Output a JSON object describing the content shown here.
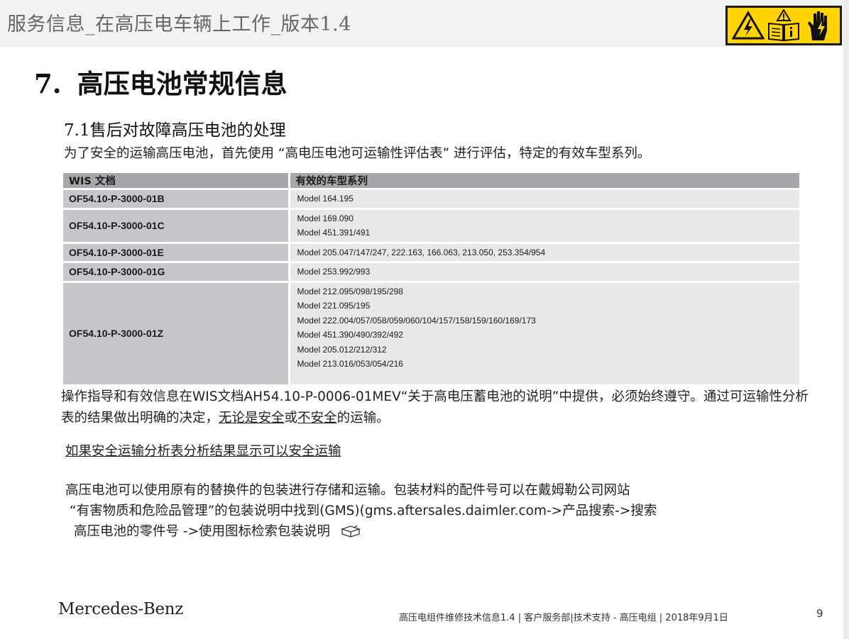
{
  "header": {
    "doc_title": "服务信息_在高压电车辆上工作_版本1.4",
    "warning_icons": [
      "high-voltage-warning-icon",
      "read-manual-icon",
      "no-touch-hand-icon"
    ],
    "warning_color": "#ffd400"
  },
  "section": {
    "number": "7.",
    "title": "高压电池常规信息"
  },
  "subsection": {
    "number": "7.1",
    "title": "售后对故障高压电池的处理"
  },
  "intro": "为了安全的运输高压电池，首先使用 “高电压电池可运输性评估表” 进行评估，特定的有效车型系列。",
  "table": {
    "headers": [
      "WIS 文档",
      "有效的车型系列"
    ],
    "rows": [
      {
        "doc": "OF54.10-P-3000-01B",
        "models": [
          "Model 164.195"
        ]
      },
      {
        "doc": "OF54.10-P-3000-01C",
        "models": [
          "Model 169.090",
          "Model 451.391/491"
        ]
      },
      {
        "doc": "OF54.10-P-3000-01E",
        "models": [
          "Model 205.047/147/247, 222.163, 166.063, 213.050, 253.354/954"
        ]
      },
      {
        "doc": "OF54.10-P-3000-01G",
        "models": [
          "Model 253.992/993"
        ]
      },
      {
        "doc": "OF54.10-P-3000-01Z",
        "models": [
          "Model 212.095/098/195/298",
          "Model 221.095/195",
          "Model 222.004/057/058/059/060/104/157/158/159/160/169/173",
          "Model 451.390/490/392/492",
          "Model 205.012/212/312",
          "Model 213.016/053/054/216"
        ]
      }
    ]
  },
  "note": {
    "part1": "操作指导和有效信息在WIS文档AH54.10-P-0006-01MEV“关于高电压蓄电池的说明”中提供，必须始终遵守。通过可运输性分析表的结果做出明确的决定，",
    "underlined1": "无论是安全",
    "middle": "或",
    "underlined2": "不安全",
    "end": "的运输。"
  },
  "safe_heading": "如果安全运输分析表分析结果显示可以安全运输",
  "paragraph": {
    "line1": "高压电池可以使用原有的替换件的包装进行存储和运输。包装材料的配件号可以在戴姆勒公司网站",
    "line2": "“有害物质和危险品管理”的包装说明中找到(GMS)(gms.aftersales.daimler.com->产品搜索->搜索",
    "line3": "高压电池的零件号 ->使用图标检索包装说明"
  },
  "footer": {
    "brand": "Mercedes-Benz",
    "info": "高压电组件维修技术信息1.4 | 客户服务部|技术支持 - 高压电组 | 2018年9月1日",
    "page": "9"
  }
}
